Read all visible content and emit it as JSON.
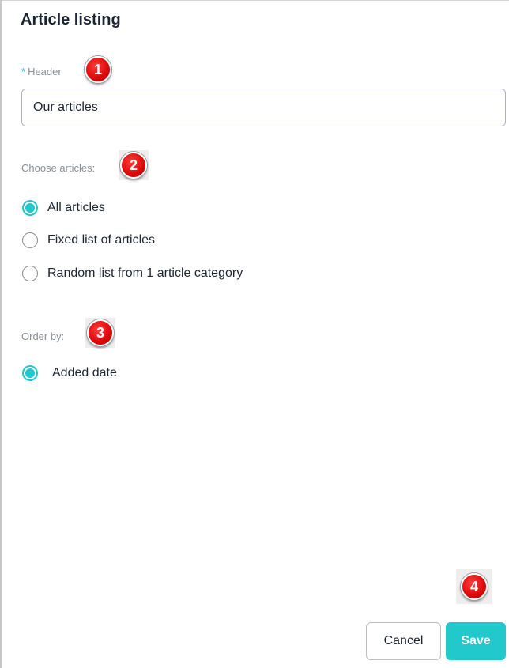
{
  "panel": {
    "title": "Article listing"
  },
  "header_field": {
    "required_mark": "*",
    "label": "Header",
    "value": "Our articles"
  },
  "choose_articles": {
    "label": "Choose articles:",
    "options": [
      {
        "label": "All articles",
        "selected": true
      },
      {
        "label": "Fixed list of articles",
        "selected": false
      },
      {
        "label": "Random list from 1 article category",
        "selected": false
      }
    ]
  },
  "order_by": {
    "label": "Order by:",
    "options": [
      {
        "label": "Added date",
        "selected": true
      }
    ]
  },
  "actions": {
    "cancel_label": "Cancel",
    "save_label": "Save"
  },
  "callouts": {
    "one": "1",
    "two": "2",
    "three": "3",
    "four": "4"
  },
  "colors": {
    "accent": "#22c9cc",
    "callout": "#d40000"
  }
}
